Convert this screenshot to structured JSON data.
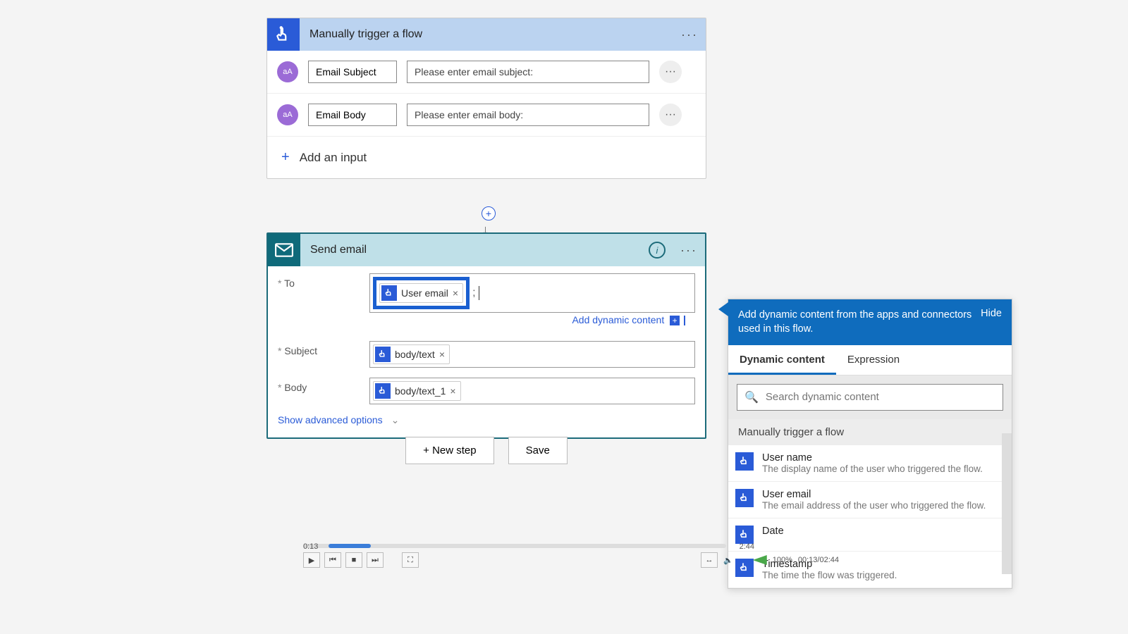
{
  "trigger": {
    "title": "Manually trigger a flow",
    "inputs": [
      {
        "name": "Email Subject",
        "prompt": "Please enter email subject:"
      },
      {
        "name": "Email Body",
        "prompt": "Please enter email body:"
      }
    ],
    "add_input": "Add an input"
  },
  "action": {
    "title": "Send email",
    "fields": {
      "to_label": "To",
      "to_token": "User email",
      "subject_label": "Subject",
      "subject_token": "body/text",
      "body_label": "Body",
      "body_token": "body/text_1"
    },
    "add_dynamic": "Add dynamic content",
    "advanced": "Show advanced options"
  },
  "buttons": {
    "new_step": "+ New step",
    "save": "Save"
  },
  "dc_panel": {
    "header": "Add dynamic content from the apps and connectors used in this flow.",
    "hide": "Hide",
    "tabs": {
      "dynamic": "Dynamic content",
      "expression": "Expression"
    },
    "search_placeholder": "Search dynamic content",
    "group": "Manually trigger a flow",
    "items": [
      {
        "name": "User name",
        "desc": "The display name of the user who triggered the flow."
      },
      {
        "name": "User email",
        "desc": "The email address of the user who triggered the flow."
      },
      {
        "name": "Date",
        "desc": ""
      },
      {
        "name": "Timestamp",
        "desc": "The time the flow was triggered."
      }
    ]
  },
  "player": {
    "elapsed_short": "0:13",
    "total_short": "2:44",
    "combined": "00:13/02:44",
    "zoom": "100%"
  }
}
